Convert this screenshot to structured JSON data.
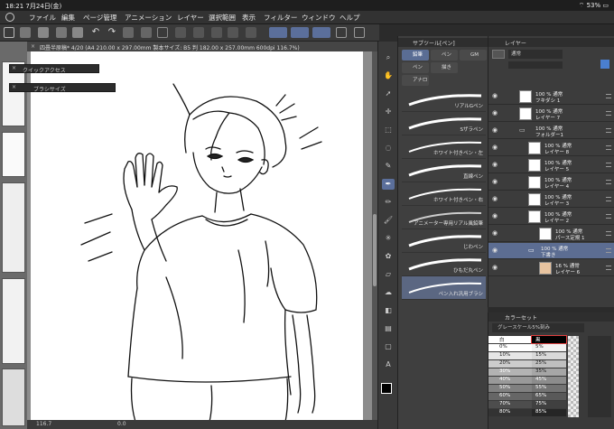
{
  "status": {
    "time": "18:21",
    "date": "7月24日(金)",
    "battery": "53%"
  },
  "menu": [
    "ファイル",
    "編集",
    "ページ管理",
    "アニメーション",
    "レイヤー",
    "選択範囲",
    "表示",
    "フィルター",
    "ウィンドウ",
    "ヘルプ"
  ],
  "tab": {
    "title": "四畳半原稿* 4/20 (A4 210.00 x 297.00mm 製本サイズ: B5 判 182.00 x 257.00mm 600dpi 116.7%)"
  },
  "quick_access": {
    "title": "クイックアクセス",
    "brush_size": "ブラシサイズ"
  },
  "canvas_footer": {
    "zoom": "116.7",
    "angle": "0.0"
  },
  "subtool": {
    "header": "サブツール[ペン]",
    "tabs": [
      "鉛筆",
      "ペン",
      "アナロ",
      "ペン",
      "描き",
      "GM"
    ],
    "brushes": [
      "リアルGペン",
      "Sザラペン",
      "ホワイト付きペン・左",
      "直線ペン",
      "ホワイト付きペン・右",
      "アニメーター専用リアル風鉛筆",
      "じわペン",
      "ひもだ丸ペン",
      "ペン入れ汎用ブラシ"
    ],
    "selected_brush": "ペン入れ汎用ブラシ"
  },
  "layers": {
    "header": "レイヤー",
    "blend": "通常",
    "items": [
      {
        "pct": "100 % 通常",
        "name": "フキダシ 1"
      },
      {
        "pct": "100 % 通常",
        "name": "レイヤー 7"
      },
      {
        "pct": "100 % 通常",
        "name": "フォルダー1"
      },
      {
        "pct": "100 % 通常",
        "name": "レイヤー 8"
      },
      {
        "pct": "100 % 通常",
        "name": "レイヤー 5"
      },
      {
        "pct": "100 % 通常",
        "name": "レイヤー 4"
      },
      {
        "pct": "100 % 通常",
        "name": "レイヤー 3"
      },
      {
        "pct": "100 % 通常",
        "name": "レイヤー 2"
      },
      {
        "pct": "100 % 通常",
        "name": "パース定規 1"
      },
      {
        "pct": "100 % 通常",
        "name": "下書き"
      },
      {
        "pct": "16 % 通常",
        "name": "レイヤー 6"
      }
    ]
  },
  "colorset": {
    "header": "カラーセット",
    "set_name": "グレースケール5%刻み",
    "left": [
      "白",
      "0%",
      "10%",
      "20%",
      "30%",
      "40%",
      "50%",
      "60%",
      "70%",
      "80%"
    ],
    "right": [
      "黒",
      "5%",
      "15%",
      "25%",
      "35%",
      "45%",
      "55%",
      "65%",
      "75%",
      "85%"
    ],
    "left_colors": [
      "#ffffff",
      "#ffffff",
      "#e6e6e6",
      "#cccccc",
      "#b3b3b3",
      "#999999",
      "#808080",
      "#666666",
      "#4d4d4d",
      "#333333"
    ],
    "right_colors": [
      "#000000",
      "#f2f2f2",
      "#d9d9d9",
      "#bfbfbf",
      "#a6a6a6",
      "#8c8c8c",
      "#737373",
      "#595959",
      "#404040",
      "#262626"
    ]
  },
  "colors": {
    "accent": "#5b6f9b",
    "panel": "#3c3c3c"
  }
}
